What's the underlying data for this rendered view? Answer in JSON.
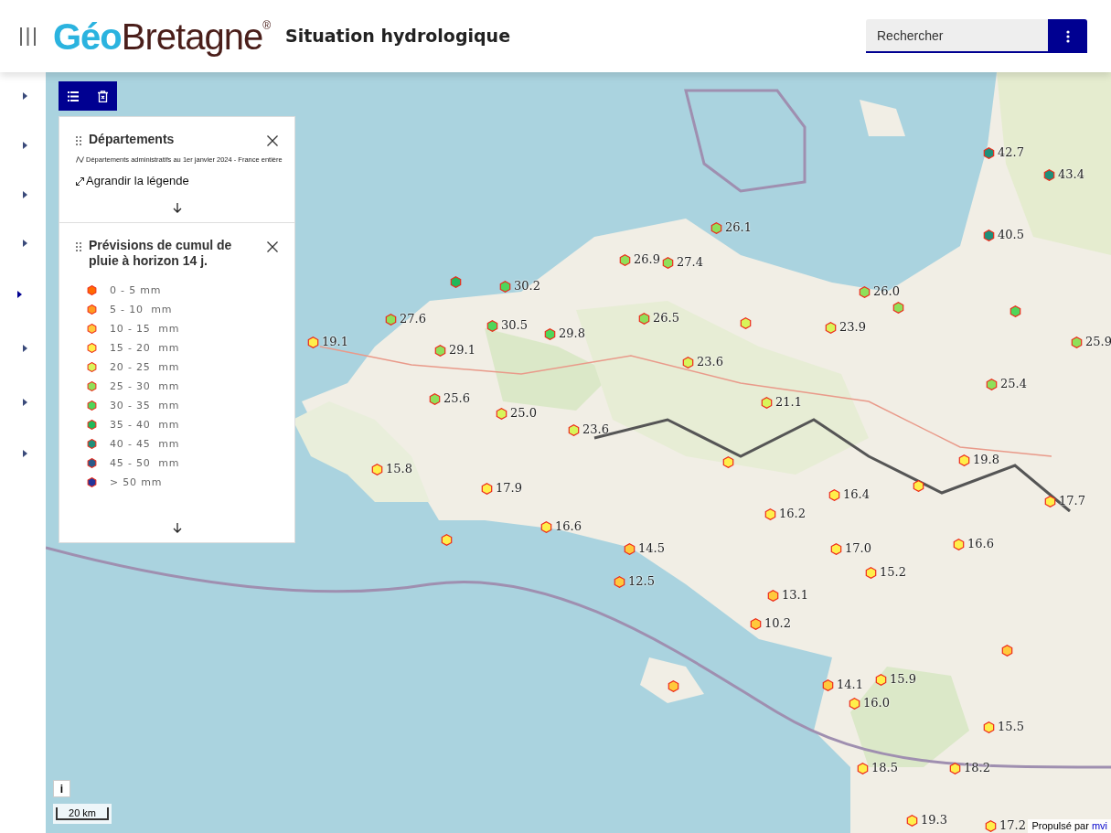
{
  "header": {
    "logo": {
      "part_1": "Géo",
      "part_2": "Bretagne",
      "mark": "®"
    },
    "title": "Situation hydrologique",
    "search": {
      "placeholder": "Rechercher"
    }
  },
  "sidebar": {
    "items": [
      {
        "selected": false
      },
      {
        "selected": false
      },
      {
        "selected": false
      },
      {
        "selected": false
      },
      {
        "selected": true
      },
      {
        "selected": false
      },
      {
        "selected": false
      },
      {
        "selected": false
      }
    ]
  },
  "legend_panels": [
    {
      "title": "Départements",
      "subtitle": "Départements administratifs au 1er janvier 2024 - France entière",
      "link": "Agrandir la légende"
    },
    {
      "title": "Prévisions de cumul de pluie à horizon 14 j.",
      "classes": [
        {
          "label": "0 - 5 mm",
          "color": "#ff6a00"
        },
        {
          "label": "5 - 10  mm",
          "color": "#ff9a1f"
        },
        {
          "label": "10 - 15  mm",
          "color": "#ffc93c"
        },
        {
          "label": "15 - 20  mm",
          "color": "#ffef4a"
        },
        {
          "label": "20 - 25  mm",
          "color": "#d8f55a"
        },
        {
          "label": "25 - 30  mm",
          "color": "#8fe05a"
        },
        {
          "label": "30 - 35  mm",
          "color": "#4fd65a"
        },
        {
          "label": "35 - 40  mm",
          "color": "#21b85a"
        },
        {
          "label": "40 - 45  mm",
          "color": "#1f8f7a"
        },
        {
          "label": "45 - 50  mm",
          "color": "#2a5a8a"
        },
        {
          "label": "> 50 mm",
          "color": "#23349a"
        }
      ]
    }
  ],
  "markers": [
    {
      "value": "26.9",
      "color": "#8fe05a"
    },
    {
      "value": "27.4",
      "color": "#8fe05a"
    },
    {
      "value": "30.2",
      "color": "#4fd65a"
    },
    {
      "color": "#21b85a"
    },
    {
      "value": "27.6",
      "color": "#8fe05a"
    },
    {
      "value": "30.5",
      "color": "#4fd65a"
    },
    {
      "value": "29.8",
      "color": "#4fd65a"
    },
    {
      "value": "29.1",
      "color": "#8fe05a"
    },
    {
      "value": "19.1",
      "color": "#ffef4a"
    },
    {
      "value": "25.6",
      "color": "#8fe05a"
    },
    {
      "value": "25.0",
      "color": "#d8f55a"
    },
    {
      "value": "23.6",
      "color": "#d8f55a"
    },
    {
      "value": "15.8",
      "color": "#ffef4a"
    },
    {
      "value": "17.9",
      "color": "#ffef4a"
    },
    {
      "color": "#ffef4a"
    },
    {
      "value": "16.6",
      "color": "#ffef4a"
    },
    {
      "value": "14.5",
      "color": "#ffc93c"
    },
    {
      "value": "12.5",
      "color": "#ffc93c"
    },
    {
      "color": "#ffc93c"
    },
    {
      "value": "26.5",
      "color": "#8fe05a"
    },
    {
      "value": "23.6",
      "color": "#d8f55a"
    },
    {
      "color": "#d8f55a"
    },
    {
      "value": "21.1",
      "color": "#d8f55a"
    },
    {
      "value": "23.9",
      "color": "#d8f55a"
    },
    {
      "value": "26.0",
      "color": "#8fe05a"
    },
    {
      "color": "#8fe05a"
    },
    {
      "value": "26.1",
      "color": "#8fe05a"
    },
    {
      "value": "42.7",
      "color": "#1f8f7a"
    },
    {
      "value": "43.4",
      "color": "#1f8f7a"
    },
    {
      "value": "40.5",
      "color": "#1f8f7a"
    },
    {
      "color": "#4fd65a"
    },
    {
      "value": "25.9",
      "color": "#8fe05a"
    },
    {
      "value": "25.4",
      "color": "#8fe05a"
    },
    {
      "color": "#ffef4a"
    },
    {
      "value": "19.8",
      "color": "#ffef4a"
    },
    {
      "color": "#ffef4a"
    },
    {
      "value": "16.4",
      "color": "#ffef4a"
    },
    {
      "value": "16.2",
      "color": "#ffef4a"
    },
    {
      "value": "17.7",
      "color": "#ffef4a"
    },
    {
      "value": "17.0",
      "color": "#ffef4a"
    },
    {
      "value": "16.6",
      "color": "#ffef4a"
    },
    {
      "value": "15.2",
      "color": "#ffef4a"
    },
    {
      "value": "13.1",
      "color": "#ffc93c"
    },
    {
      "value": "10.2",
      "color": "#ffc93c"
    },
    {
      "color": "#ffc93c"
    },
    {
      "value": "14.1",
      "color": "#ffc93c"
    },
    {
      "value": "15.9",
      "color": "#ffef4a"
    },
    {
      "value": "16.0",
      "color": "#ffef4a"
    },
    {
      "value": "15.5",
      "color": "#ffef4a"
    },
    {
      "value": "18.5",
      "color": "#ffef4a"
    },
    {
      "value": "18.2",
      "color": "#ffef4a"
    },
    {
      "value": "19.3",
      "color": "#ffef4a"
    },
    {
      "value": "17.2",
      "color": "#ffef4a"
    }
  ],
  "info_button": "i",
  "scale": "20 km",
  "attribution": {
    "text": "Propulsé par",
    "link": "mvi"
  }
}
